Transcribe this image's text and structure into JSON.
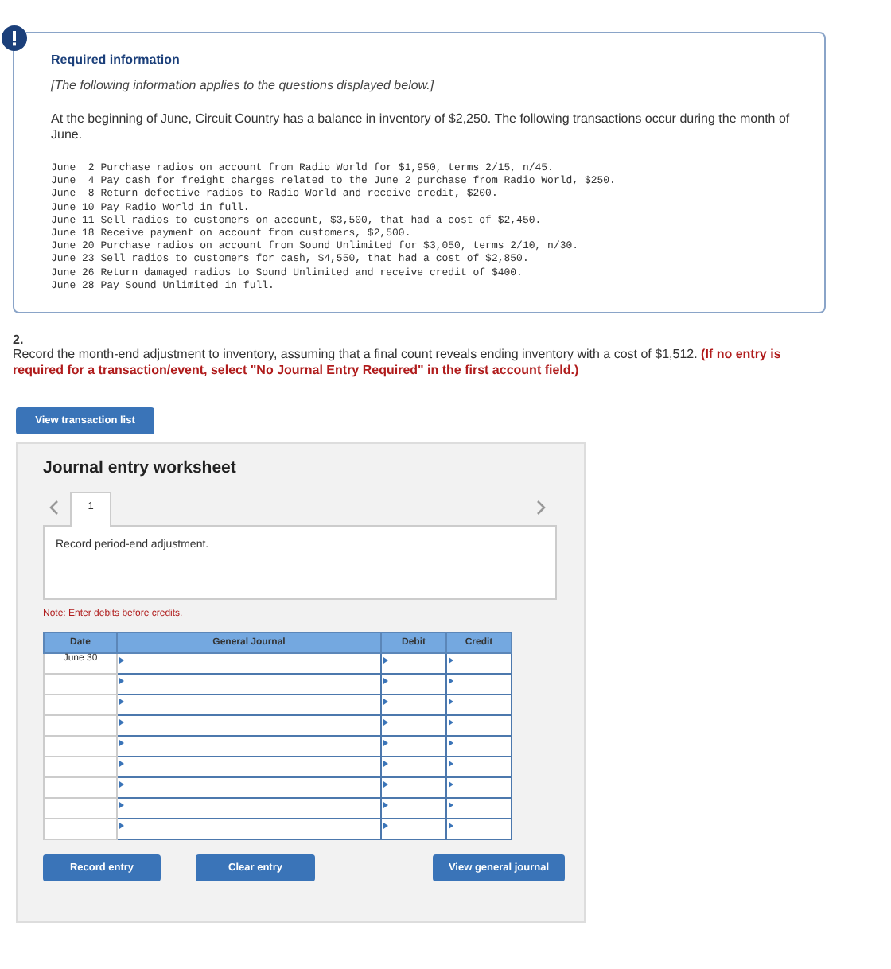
{
  "info": {
    "title": "Required information",
    "note": "[The following information applies to the questions displayed below.]",
    "intro": "At the beginning of June, Circuit Country has a balance in inventory of $2,250. The following transactions occur during the month of June.",
    "transactions": [
      "June  2 Purchase radios on account from Radio World for $1,950, terms 2/15, n/45.",
      "June  4 Pay cash for freight charges related to the June 2 purchase from Radio World, $250.",
      "June  8 Return defective radios to Radio World and receive credit, $200.",
      "June 10 Pay Radio World in full.",
      "June 11 Sell radios to customers on account, $3,500, that had a cost of $2,450.",
      "June 18 Receive payment on account from customers, $2,500.",
      "June 20 Purchase radios on account from Sound Unlimited for $3,050, terms 2/10, n/30.",
      "June 23 Sell radios to customers for cash, $4,550, that had a cost of $2,850.",
      "June 26 Return damaged radios to Sound Unlimited and receive credit of $400.",
      "June 28 Pay Sound Unlimited in full."
    ]
  },
  "question": {
    "number": "2.",
    "text": "Record the month-end adjustment to inventory, assuming that a final count reveals ending inventory with a cost of $1,512. **(If no entry is required for a transaction/event, select \"No Journal Entry Required\" in the first account field.)**"
  },
  "view_transactions_button": "View transaction list",
  "worksheet": {
    "title": "Journal entry worksheet",
    "tabs": [
      {
        "label": "1",
        "selected": true
      }
    ],
    "description": "Record period-end adjustment.",
    "note": "Note: Enter debits before credits.",
    "columns": [
      "Date",
      "General Journal",
      "Debit",
      "Credit"
    ],
    "rows": [
      {
        "date": "June 30"
      },
      {},
      {},
      {},
      {},
      {},
      {},
      {},
      {}
    ],
    "buttons": [
      "Record entry",
      "Clear entry",
      "View general journal"
    ]
  }
}
